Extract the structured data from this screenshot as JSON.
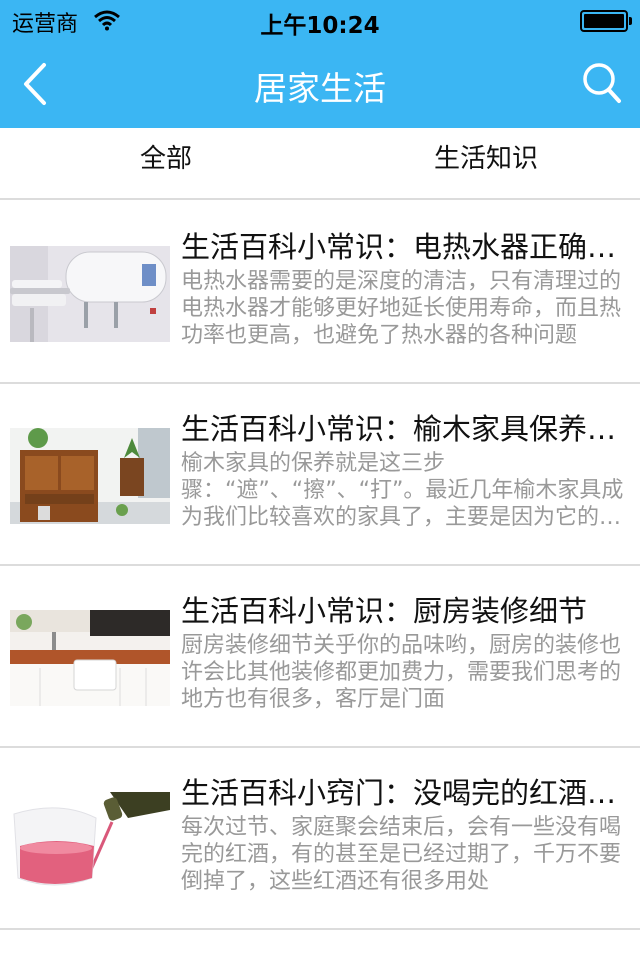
{
  "status_bar": {
    "carrier": "运营商",
    "time": "上午10:24"
  },
  "nav": {
    "title": "居家生活",
    "back_icon": "chevron-left-icon",
    "search_icon": "search-icon"
  },
  "tabs": [
    {
      "label": "全部"
    },
    {
      "label": "生活知识"
    }
  ],
  "articles": [
    {
      "title": "生活百科小常识：电热水器正确清洗方法",
      "summary": "电热水器需要的是深度的清洁，只有清理过的电热水器才能够更好地延长使用寿命，而且热功率也更高，也避免了热水器的各种问题"
    },
    {
      "title": "生活百科小常识：榆木家具保养方法",
      "summary": "榆木家具的保养就是这三步骤：“遮”、“擦”、“打”。最近几年榆木家具成为我们比较喜欢的家具了，主要是因为它的纹理"
    },
    {
      "title": "生活百科小常识：厨房装修细节",
      "summary": "厨房装修细节关乎你的品味哟，厨房的装修也许会比其他装修都更加费力，需要我们思考的地方也有很多，客厅是门面"
    },
    {
      "title": "生活百科小窍门：没喝完的红酒妙用",
      "summary": "每次过节、家庭聚会结束后，会有一些没有喝完的红酒，有的甚至是已经过期了，千万不要倒掉了，这些红酒还有很多用处"
    }
  ],
  "colors": {
    "nav_bg": "#3bb6f3",
    "title_text": "#ffffff",
    "summary_text": "#999999"
  }
}
